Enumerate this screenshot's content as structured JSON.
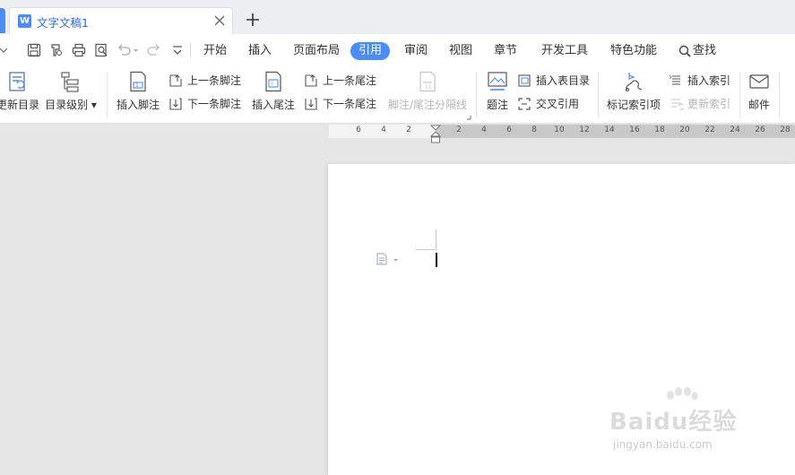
{
  "tab": {
    "title": "文字文稿1",
    "icon": "W"
  },
  "menu": {
    "items": [
      "开始",
      "插入",
      "页面布局",
      "引用",
      "审阅",
      "视图",
      "章节",
      "开发工具",
      "特色功能",
      "查找"
    ],
    "active": "引用"
  },
  "ribbon": {
    "update_toc": "更新目录",
    "toc_level": "目录级别",
    "insert_footnote": "插入脚注",
    "prev_footnote": "上一条脚注",
    "next_footnote": "下一条脚注",
    "insert_endnote": "插入尾注",
    "prev_endnote": "上一条尾注",
    "next_endnote": "下一条尾注",
    "separator_line": "脚注/尾注分隔线",
    "caption": "题注",
    "insert_table_of_figures": "插入表目录",
    "cross_reference": "交叉引用",
    "mark_index_entry": "标记索引项",
    "insert_index": "插入索引",
    "update_index": "更新索引",
    "mail": "邮件"
  },
  "ruler": {
    "left_ticks": [
      "6",
      "4",
      "2"
    ],
    "right_ticks": [
      "2",
      "4",
      "6",
      "8",
      "10",
      "12",
      "14",
      "16",
      "18",
      "20",
      "22",
      "24",
      "26",
      "28"
    ]
  },
  "watermark": {
    "logo": "Baidu经验",
    "url": "jingyan.baidu.com"
  },
  "colors": {
    "accent": "#4b8cf5",
    "tabbar": "#eceef1",
    "workspace": "#e6e6e6"
  }
}
